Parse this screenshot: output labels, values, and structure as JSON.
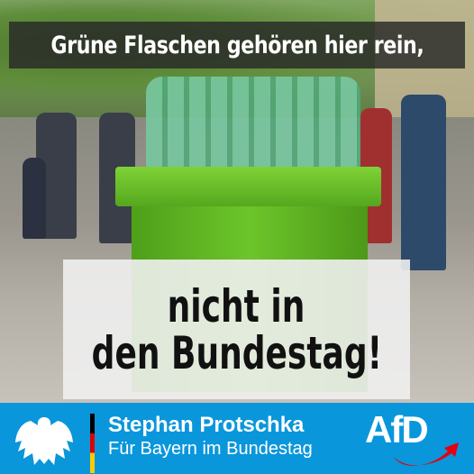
{
  "headline_top": "Grüne Flaschen gehören hier rein,",
  "headline_main": [
    "nicht in",
    "den Bundestag!"
  ],
  "banner": {
    "name": "Stephan Protschka",
    "subtitle": "Für Bayern im Bundestag",
    "party_logo": "AfD",
    "colors": {
      "background": "#0a96db",
      "logo_swoosh": "#e3000f"
    }
  },
  "icons": [
    "federal-eagle-icon",
    "german-flag-stripe"
  ]
}
